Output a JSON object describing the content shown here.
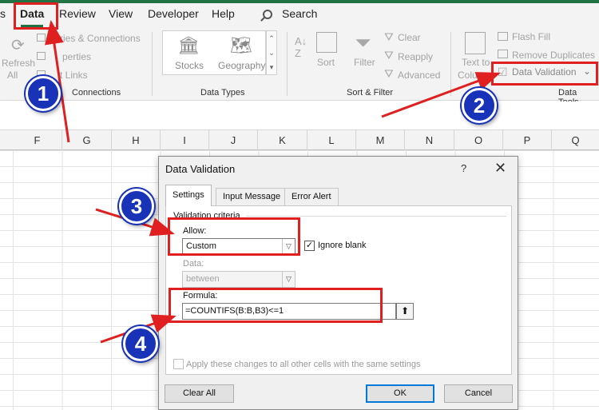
{
  "ribbon_tabs": {
    "file_fragment": "s",
    "data": "Data",
    "review": "Review",
    "view": "View",
    "developer": "Developer",
    "help": "Help",
    "search": "Search"
  },
  "ribbon": {
    "refresh": "Refresh",
    "refresh_all": "All",
    "queries_connections": "ries & Connections",
    "properties": "perties",
    "edit_links": "t Links",
    "group_queries": "Connections",
    "stocks": "Stocks",
    "geography": "Geography",
    "group_data_types": "Data Types",
    "sort": "Sort",
    "filter": "Filter",
    "clear": "Clear",
    "reapply": "Reapply",
    "advanced": "Advanced",
    "group_sort_filter": "Sort & Filter",
    "text_to": "Text to",
    "columns": "Columns",
    "flash_fill": "Flash Fill",
    "remove_duplicates": "Remove Duplicates",
    "data_validation": "Data Validation",
    "group_data_tools": "Data Tools"
  },
  "columns": [
    "F",
    "G",
    "H",
    "I",
    "J",
    "K",
    "L",
    "M",
    "N",
    "O",
    "P",
    "Q"
  ],
  "dialog": {
    "title": "Data Validation",
    "help": "?",
    "close": "✕",
    "tabs": [
      "Settings",
      "Input Message",
      "Error Alert"
    ],
    "section": "Validation criteria",
    "allow_label": "Allow:",
    "allow_value": "Custom",
    "ignore_blank": "Ignore blank",
    "ignore_blank_checked": true,
    "data_label": "Data:",
    "data_value": "between",
    "formula_label": "Formula:",
    "formula_value": "=COUNTIFS(B:B,B3)<=1",
    "apply_all": "Apply these changes to all other cells with the same settings",
    "clear_all": "Clear All",
    "ok": "OK",
    "cancel": "Cancel"
  },
  "badges": [
    "1",
    "2",
    "3",
    "4"
  ],
  "colors": {
    "annotation_red": "#e02020",
    "badge_blue": "#1832b8",
    "excel_green": "#217346"
  }
}
